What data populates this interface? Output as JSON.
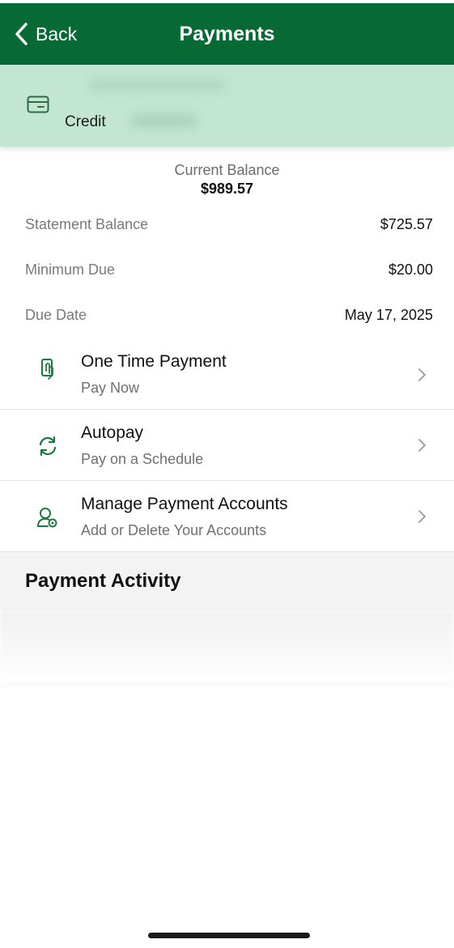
{
  "navbar": {
    "back_label": "Back",
    "title": "Payments",
    "background": "#076a35"
  },
  "account": {
    "icon": "credit-card-icon",
    "type_label": "Credit",
    "background": "#c2e6d2"
  },
  "balance": {
    "current_label": "Current Balance",
    "current_value": "$989.57"
  },
  "details": [
    {
      "label": "Statement Balance",
      "value": "$725.57"
    },
    {
      "label": "Minimum Due",
      "value": "$20.00"
    },
    {
      "label": "Due Date",
      "value": "May 17, 2025"
    }
  ],
  "actions": [
    {
      "title": "One Time Payment",
      "subtitle": "Pay Now",
      "icon": "tap-payment-icon"
    },
    {
      "title": "Autopay",
      "subtitle": "Pay on a Schedule",
      "icon": "refresh-cycle-icon"
    },
    {
      "title": "Manage Payment Accounts",
      "subtitle": "Add or Delete Your Accounts",
      "icon": "user-settings-icon"
    }
  ],
  "activity": {
    "title": "Payment Activity"
  },
  "accent_color": "#1e7a43"
}
